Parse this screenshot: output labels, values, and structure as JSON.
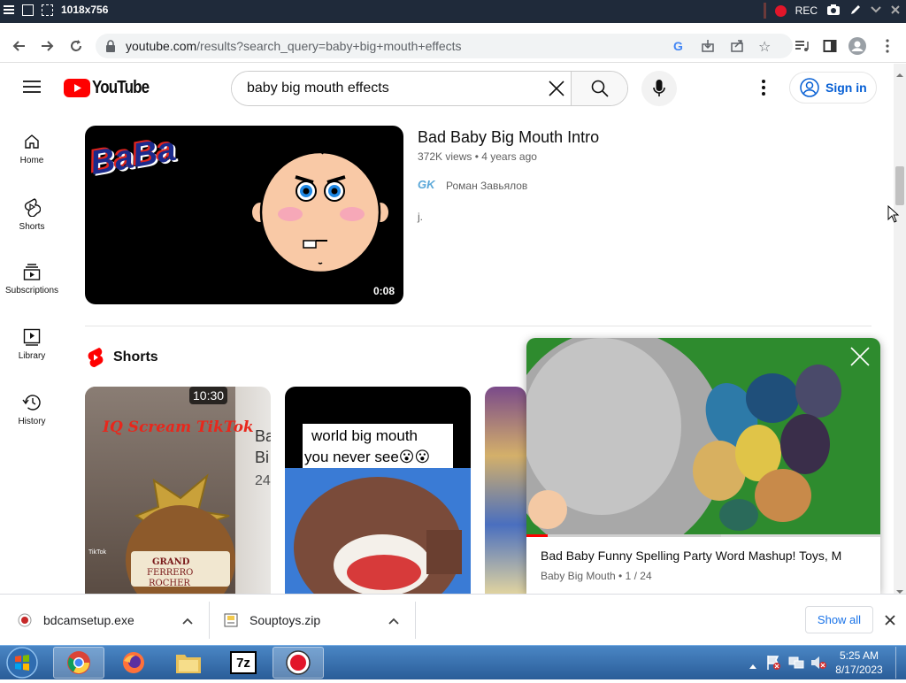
{
  "recorder": {
    "title": "1018x756",
    "rec_label": "REC"
  },
  "browser": {
    "url_host": "youtube.com",
    "url_path": "/results?search_query=baby+big+mouth+effects"
  },
  "youtube": {
    "logo_text": "YouTube",
    "search": {
      "value": "baby big mouth effects"
    },
    "signin_label": "Sign in"
  },
  "sidebar": {
    "items": [
      {
        "label": "Home",
        "icon": "home-icon"
      },
      {
        "label": "Shorts",
        "icon": "shorts-icon"
      },
      {
        "label": "Subscriptions",
        "icon": "subscriptions-icon"
      },
      {
        "label": "Library",
        "icon": "library-icon"
      },
      {
        "label": "History",
        "icon": "history-icon"
      }
    ]
  },
  "result": {
    "title": "Bad Baby Big Mouth Intro",
    "meta": "372K views • 4 years ago",
    "channel": "Роман Завьялов",
    "channel_avatar_text": "GK",
    "description": "j.",
    "duration": "0:08",
    "thumb_text": "BaBa"
  },
  "shorts": {
    "heading": "Shorts",
    "items": [
      {
        "duration": "10:30",
        "overlay": "IQ Scream TikTok",
        "side_text_1": "Ba",
        "side_text_2": "Bi",
        "side_text_3": "24",
        "tiktok": "TikTok",
        "box_text_1": "GRAND",
        "box_text_2": "FERRERO",
        "box_text_3": "ROCHER"
      },
      {
        "caption_1": "world big mouth",
        "caption_2": "you never see😮😮"
      },
      {}
    ]
  },
  "miniplayer": {
    "title": "Bad Baby Funny Spelling Party Word Mashup! Toys, M",
    "channel": "Baby Big Mouth",
    "position": "1 / 24",
    "progress": 0.06,
    "buffered": 0.55
  },
  "downloads": {
    "items": [
      {
        "name": "bdcamsetup.exe"
      },
      {
        "name": "Souptoys.zip"
      }
    ],
    "show_all": "Show all"
  },
  "taskbar": {
    "time": "5:25 AM",
    "date": "8/17/2023",
    "app_7z": "7z"
  },
  "colors": {
    "yt_red": "#ff0000",
    "link_blue": "#065fd4",
    "chrome_blue": "#1a73e8"
  }
}
